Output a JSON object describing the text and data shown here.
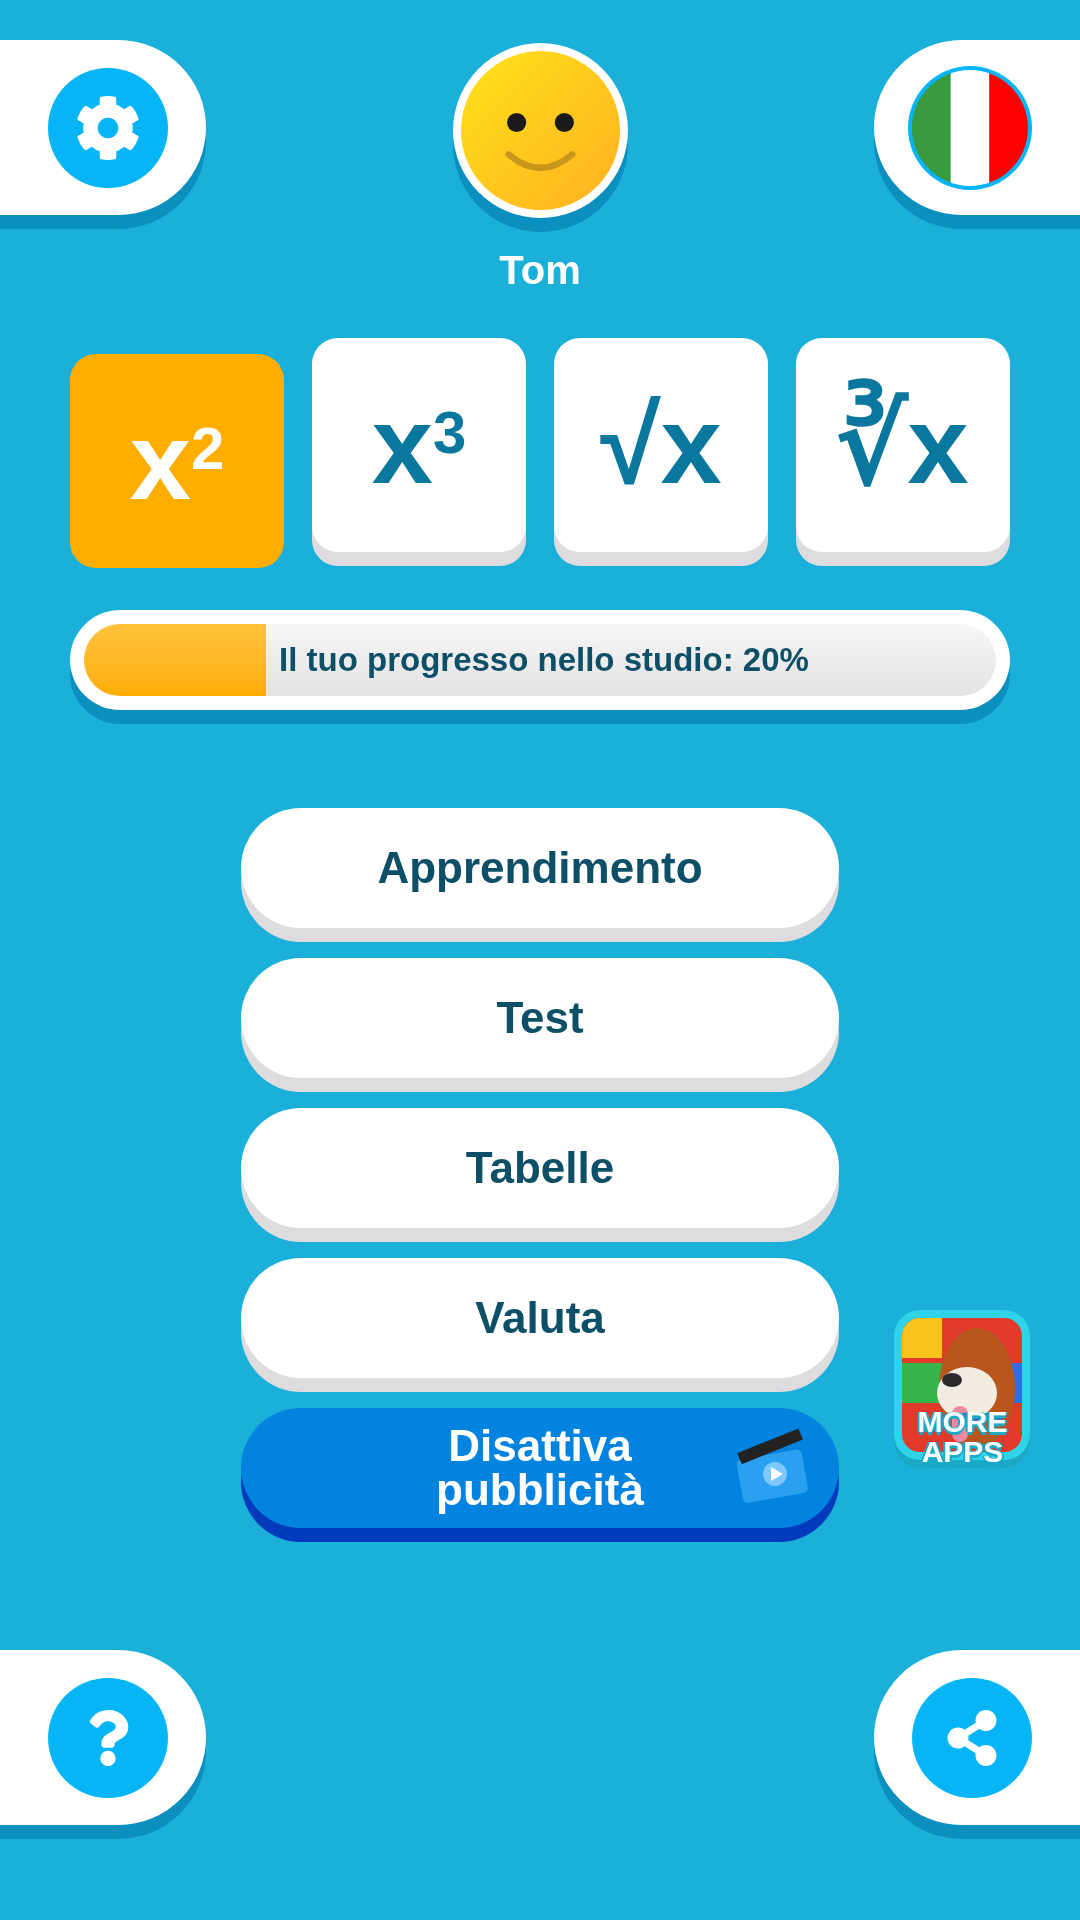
{
  "profile": {
    "name": "Tom"
  },
  "tiles": [
    {
      "label": "x$^{2}$",
      "selected": true
    },
    {
      "label": "x$^{3}$",
      "selected": false
    },
    {
      "label": "√x",
      "selected": false
    },
    {
      "label": "∛x",
      "selected": false
    }
  ],
  "progress": {
    "label": "Il tuo progresso nello studio: 20%",
    "level": 0.2
  },
  "menu": [
    {
      "label": "Apprendimento",
      "kind": "plain"
    },
    {
      "label": "Test",
      "kind": "plain"
    },
    {
      "label": "Tabelle",
      "kind": "plain"
    },
    {
      "label": "Valuta",
      "kind": "plain"
    },
    {
      "label": "Disattiva pubblicità",
      "kind": "video"
    }
  ],
  "more_apps": {
    "label": "MORE APPS"
  }
}
